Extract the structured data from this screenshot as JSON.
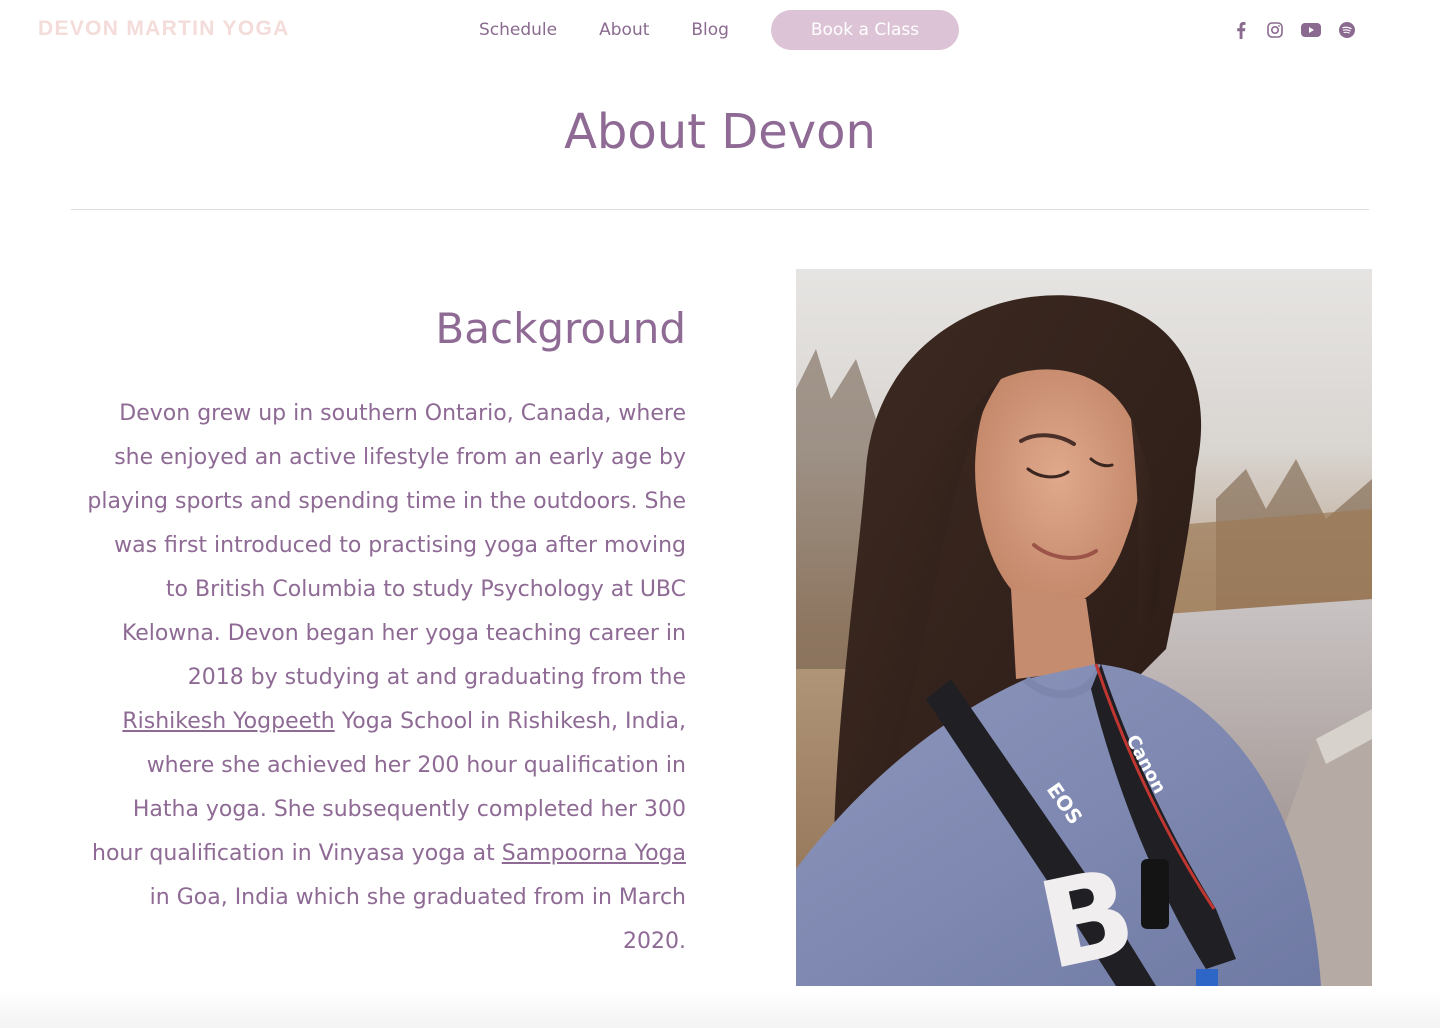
{
  "header": {
    "logo": "DEVON MARTIN YOGA",
    "nav": [
      {
        "label": "Schedule"
      },
      {
        "label": "About"
      },
      {
        "label": "Blog"
      }
    ],
    "cta_label": "Book a Class",
    "social": [
      {
        "icon": "facebook-icon"
      },
      {
        "icon": "instagram-icon"
      },
      {
        "icon": "youtube-icon"
      },
      {
        "icon": "spotify-icon"
      }
    ]
  },
  "page": {
    "title": "About Devon"
  },
  "background": {
    "heading": "Background",
    "bio_part1": "Devon grew up in southern Ontario, Canada, where she enjoyed an active lifestyle from an early age by playing sports and spending time in the outdoors. She was first introduced to practising yoga after moving to British Columbia to study Psychology at UBC Kelowna. Devon began her yoga teaching career in 2018 by studying at and graduating from the ",
    "link1": "Rishikesh Yogpeeth",
    "bio_part2": " Yoga School in Rishikesh, India, where she achieved her 200 hour qualification in Hatha yoga. She subsequently completed her 300 hour qualification in Vinyasa yoga at ",
    "link2": "Sampoorna Yoga",
    "bio_part3": " in Goa, India which she graduated from in March 2020."
  },
  "photo": {
    "strap_text": "EOS",
    "strap_text_2": "Canon",
    "shirt_letter": "B"
  },
  "colors": {
    "accent": "#8e6a95",
    "button_bg": "#dcc3d6",
    "logo": "#f3dcd9"
  }
}
